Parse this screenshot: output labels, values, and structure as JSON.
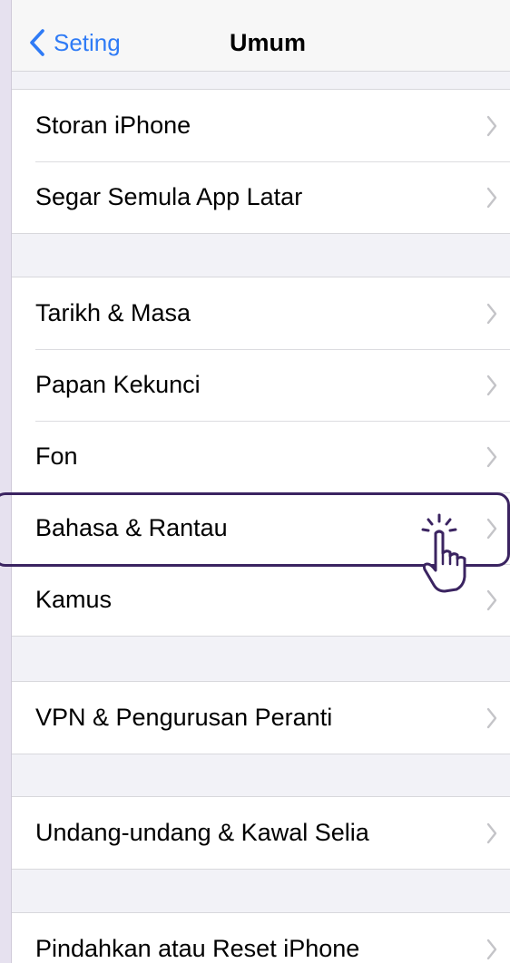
{
  "navbar": {
    "back_label": "Seting",
    "title": "Umum"
  },
  "groups": [
    {
      "items": [
        {
          "label": "Storan iPhone"
        },
        {
          "label": "Segar Semula App Latar"
        }
      ]
    },
    {
      "items": [
        {
          "label": "Tarikh & Masa"
        },
        {
          "label": "Papan Kekunci"
        },
        {
          "label": "Fon"
        },
        {
          "label": "Bahasa & Rantau"
        },
        {
          "label": "Kamus"
        }
      ]
    },
    {
      "items": [
        {
          "label": "VPN & Pengurusan Peranti"
        }
      ]
    },
    {
      "items": [
        {
          "label": "Undang-undang & Kawal Selia"
        }
      ]
    },
    {
      "items": [
        {
          "label": "Pindahkan atau Reset iPhone"
        }
      ]
    }
  ],
  "highlighted_item": "Bahasa & Rantau",
  "colors": {
    "accent": "#2f7bf6",
    "highlight_border": "#3b2461",
    "background": "#f2f2f7"
  },
  "icons": {
    "back": "chevron-left-icon",
    "row_disclosure": "chevron-right-icon",
    "pointer": "hand-pointer-icon"
  }
}
